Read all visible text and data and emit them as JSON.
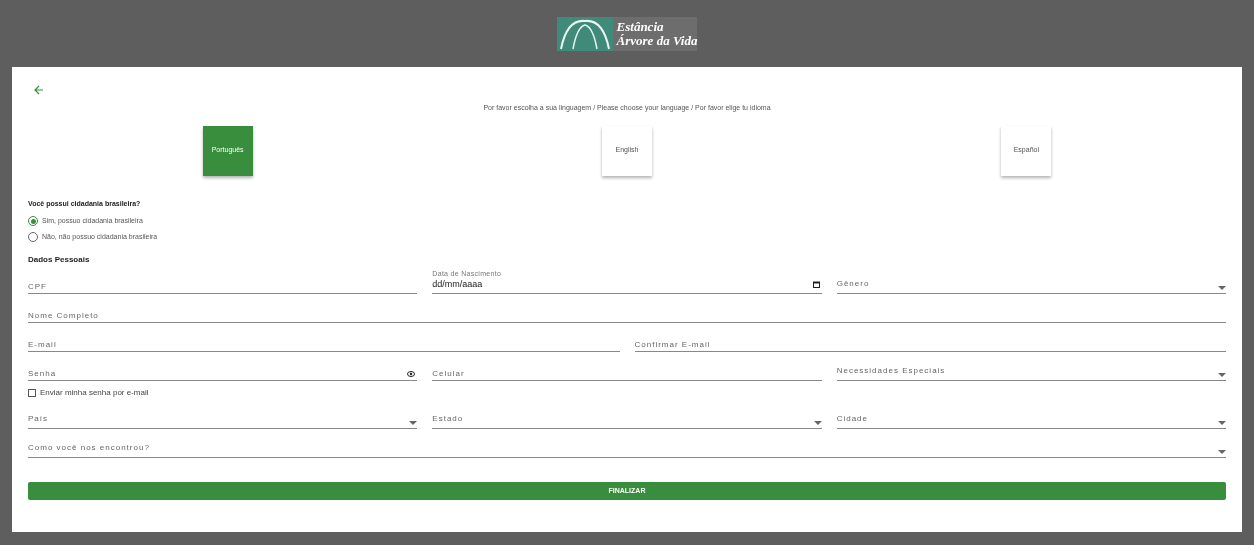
{
  "logo": {
    "line_1": "Estância",
    "line_2": "Árvore da Vida"
  },
  "language_prompt": "Por favor escolha a sua linguagem / Please choose your language / Por favor elige tu idioma",
  "languages": [
    {
      "label": "Português",
      "selected": true
    },
    {
      "label": "English",
      "selected": false
    },
    {
      "label": "Español",
      "selected": false
    }
  ],
  "citizenship": {
    "question": "Você possui cidadania brasileira?",
    "options": [
      {
        "label": "Sim, possuo cidadania brasileira",
        "selected": true
      },
      {
        "label": "Não, não possuo cidadania brasileira",
        "selected": false
      }
    ]
  },
  "section_title": "Dados Pessoais",
  "rows": [
    [
      {
        "kind": "text",
        "placeholder": "CPF"
      },
      {
        "kind": "date",
        "label": "Data de Nascimento",
        "value": "dd/mm/aaaa"
      },
      {
        "kind": "select",
        "placeholder": "Gênero"
      }
    ],
    [
      {
        "kind": "text",
        "placeholder": "Nome Completo"
      }
    ],
    [
      {
        "kind": "text",
        "placeholder": "E-mail"
      },
      {
        "kind": "text",
        "placeholder": "Confirmar E-mail"
      }
    ],
    [
      {
        "kind": "password",
        "placeholder": "Senha"
      },
      {
        "kind": "text",
        "placeholder": "Celular"
      },
      {
        "kind": "select",
        "placeholder": "Necessidades Especiais"
      }
    ],
    [
      {
        "kind": "checkbox",
        "label": "Enviar minha senha por e-mail",
        "checked": false
      }
    ],
    [
      {
        "kind": "select",
        "placeholder": "País"
      },
      {
        "kind": "select",
        "placeholder": "Estado"
      },
      {
        "kind": "select",
        "placeholder": "Cidade"
      }
    ],
    [
      {
        "kind": "select",
        "placeholder": "Como você nos encontrou?"
      }
    ]
  ],
  "submit_button": "FINALIZAR"
}
